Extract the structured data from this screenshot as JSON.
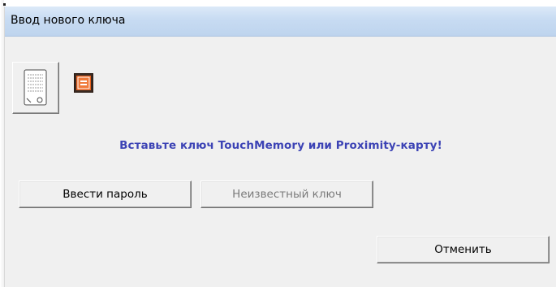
{
  "window": {
    "title": "Ввод нового ключа"
  },
  "toolbar": {
    "key_button_icon": "touch-memory-device-icon",
    "status_icon": "orange-reader-icon"
  },
  "message": {
    "prompt": "Вставьте ключ TouchMemory или Proximity-карту!"
  },
  "buttons": {
    "enter_password": "Ввести пароль",
    "unknown_key": "Неизвестный ключ",
    "cancel": "Отменить"
  },
  "colors": {
    "prompt_text": "#3c43b5",
    "titlebar": "#c7dbf2",
    "dialog_bg": "#f0f0f0",
    "status_icon_fill": "#e8621f",
    "disabled_text": "#7a7a7a"
  }
}
